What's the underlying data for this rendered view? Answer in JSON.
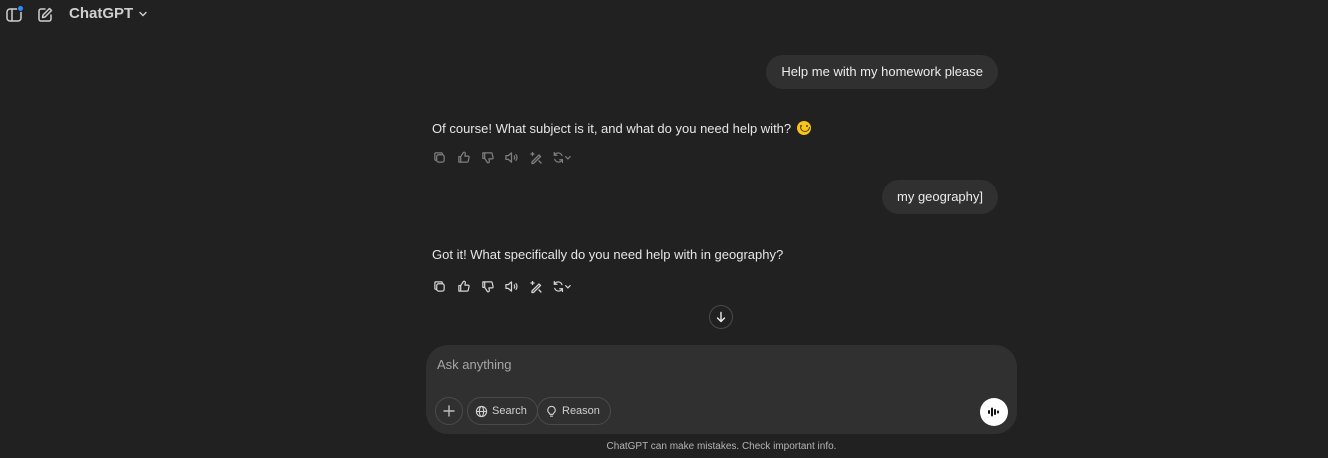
{
  "header": {
    "model_name": "ChatGPT",
    "icons": [
      "sidebar-toggle-icon",
      "new-chat-icon",
      "chevron-down-icon"
    ],
    "accent_dot_color": "#2f8cff"
  },
  "conversation": {
    "messages": [
      {
        "role": "user",
        "text": "Help me with my homework please"
      },
      {
        "role": "assistant",
        "text": "Of course! What subject is it, and what do you need help with?",
        "emoji": "smiling-face"
      },
      {
        "role": "user",
        "text": "my geography]"
      },
      {
        "role": "assistant",
        "text": "Got it! What specifically do you need help with in geography?"
      }
    ],
    "action_icons": [
      "copy-icon",
      "thumbs-up-icon",
      "thumbs-down-icon",
      "read-aloud-icon",
      "edit-canvas-icon",
      "regenerate-icon"
    ]
  },
  "composer": {
    "placeholder": "Ask anything",
    "buttons": {
      "search": "Search",
      "reason": "Reason"
    }
  },
  "footer": {
    "disclaimer": "ChatGPT can make mistakes. Check important info."
  },
  "colors": {
    "background": "#212121",
    "bubble": "#303030",
    "text": "#ececec"
  }
}
